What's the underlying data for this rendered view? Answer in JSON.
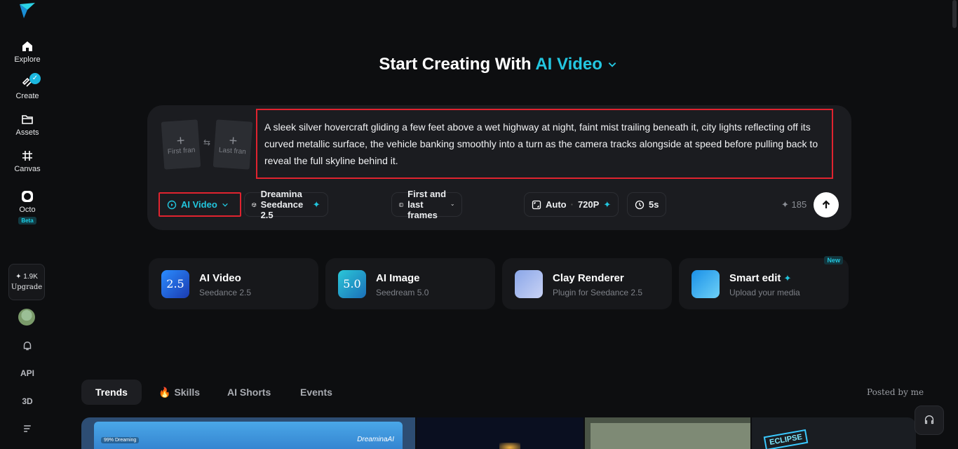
{
  "sidebar": {
    "logo": "paper-plane-logo",
    "items": [
      {
        "label": "Explore",
        "icon": "home-icon"
      },
      {
        "label": "Create",
        "icon": "create-icon"
      },
      {
        "label": "Assets",
        "icon": "folder-icon"
      },
      {
        "label": "Canvas",
        "icon": "canvas-grid-icon"
      },
      {
        "label": "Octo",
        "icon": "octo-icon",
        "badge": "Beta"
      }
    ],
    "credits": "1.9K",
    "upgrade_label": "Upgrade",
    "bottom": {
      "api": "API",
      "three_d": "3D"
    }
  },
  "header": {
    "prefix": "Start Creating With",
    "mode": "AI Video"
  },
  "prompt": {
    "first_frame": "First fran",
    "last_frame": "Last fran",
    "text": "A sleek silver hovercraft gliding a few feet above a wet highway at night, faint mist trailing beneath it, city lights reflecting off its curved metallic surface, the vehicle banking smoothly into a turn as the camera tracks alongside at speed before pulling back to reveal the full skyline behind it."
  },
  "toolbar": {
    "type_label": "AI Video",
    "model_label": "Dreamina Seedance 2.5",
    "frames_label": "First and last frames",
    "ratio_label": "Auto",
    "resolution_label": "720P",
    "duration_label": "5s",
    "credit_cost": "185"
  },
  "features": [
    {
      "title": "AI Video",
      "subtitle": "Seedance 2.5",
      "thumb_text": "2.5"
    },
    {
      "title": "AI Image",
      "subtitle": "Seedream 5.0",
      "thumb_text": "5.0"
    },
    {
      "title": "Clay Renderer",
      "subtitle": "Plugin for Seedance 2.5"
    },
    {
      "title": "Smart edit",
      "subtitle": "Upload your media",
      "badge": "New"
    }
  ],
  "tabs": [
    "Trends",
    "Skills",
    "AI Shorts",
    "Events"
  ],
  "posted_label": "Posted by me",
  "gallery": {
    "tile1_badge": "99% Dreaming",
    "tile1_brand": "DreaminaAI",
    "tile4_sign": "ECLIPSE"
  }
}
